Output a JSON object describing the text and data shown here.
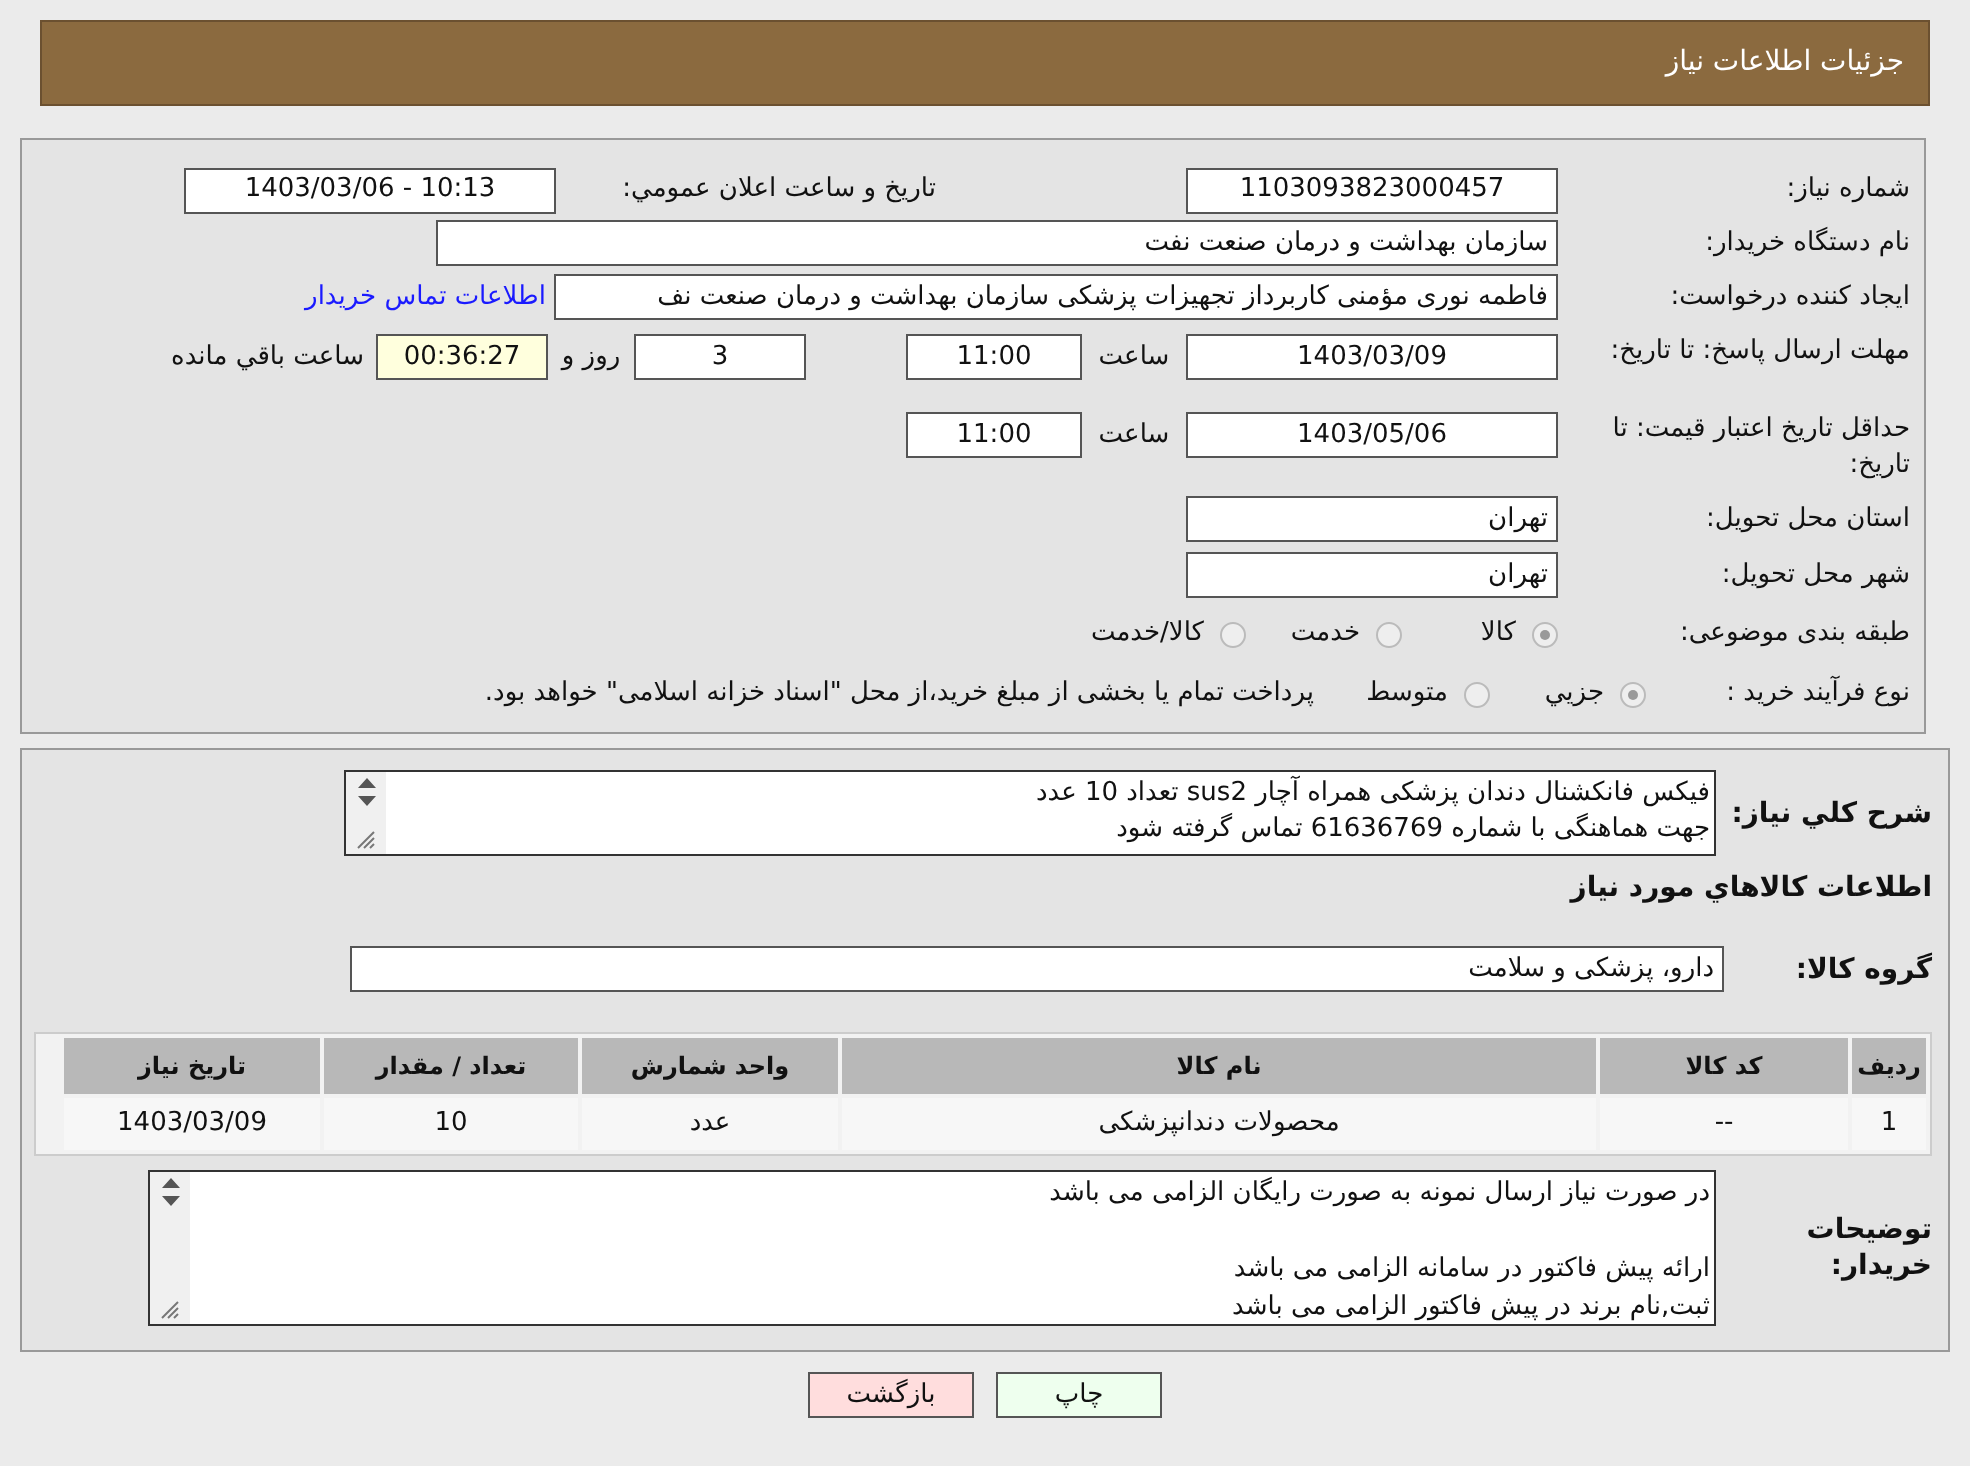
{
  "header": {
    "title": "جزئیات اطلاعات نیاز"
  },
  "need_number": {
    "label": "شماره نیاز:",
    "value": "1103093823000457"
  },
  "announce": {
    "label": "تاریخ و ساعت اعلان عمومي:",
    "value": "1403/03/06 - 10:13"
  },
  "buyer": {
    "label": "نام دستگاه خریدار:",
    "value": "سازمان بهداشت و درمان صنعت نفت"
  },
  "creator": {
    "label": "ایجاد کننده درخواست:",
    "value": "فاطمه نوری مؤمنی کاربرداز تجهیزات پزشکی سازمان بهداشت و درمان صنعت نف",
    "link": "اطلاعات تماس خریدار"
  },
  "deadline": {
    "label": "مهلت ارسال پاسخ: تا تاریخ:",
    "date": "1403/03/09",
    "time_label": "ساعت",
    "time": "11:00",
    "days": "3",
    "days_label": "روز و",
    "remaining": "00:36:27",
    "remaining_label": "ساعت باقي مانده"
  },
  "validity": {
    "label": "حداقل تاریخ اعتبار قیمت: تا تاریخ:",
    "date": "1403/05/06",
    "time_label": "ساعت",
    "time": "11:00"
  },
  "province": {
    "label": "استان محل تحویل:",
    "value": "تهران"
  },
  "city": {
    "label": "شهر محل تحویل:",
    "value": "تهران"
  },
  "category": {
    "label": "طبقه بندی موضوعی:",
    "options": [
      {
        "label": "کالا",
        "selected": true
      },
      {
        "label": "خدمت",
        "selected": false
      },
      {
        "label": "کالا/خدمت",
        "selected": false
      }
    ]
  },
  "purchase_type": {
    "label": "نوع فرآیند خرید :",
    "options": [
      {
        "label": "جزیي",
        "selected": true
      },
      {
        "label": "متوسط",
        "selected": false
      }
    ],
    "note": "پرداخت تمام یا بخشی از مبلغ خرید،از محل \"اسناد خزانه اسلامی\" خواهد بود."
  },
  "description": {
    "label": "شرح کلي نياز:",
    "lines": [
      "فیکس فانکشنال دندان پزشکی همراه آچار sus2 تعداد 10 عدد",
      "جهت هماهنگی با شماره 61636769 تماس گرفته شود"
    ]
  },
  "goods_heading": "اطلاعات کالاهاي مورد نياز",
  "goods_group": {
    "label": "گروه کالا:",
    "value": "دارو، پزشکی و سلامت"
  },
  "table": {
    "columns": [
      "ردیف",
      "کد کالا",
      "نام کالا",
      "واحد شمارش",
      "تعداد / مقدار",
      "تاریخ نیاز"
    ],
    "rows": [
      [
        "1",
        "--",
        "محصولات دندانپزشکی",
        "عدد",
        "10",
        "1403/03/09"
      ]
    ]
  },
  "buyer_notes": {
    "label": "توضیحات خریدار:",
    "paragraphs": [
      [
        "در صورت نیاز ارسال نمونه به صورت رایگان الزامی می باشد"
      ],
      [
        "ارائه پیش فاکتور در سامانه الزامی می باشد",
        "ثبت,نام برند در پیش فاکتور الزامی می باشد"
      ]
    ]
  },
  "buttons": [
    {
      "label": "چاپ",
      "kind": "print"
    },
    {
      "label": "بازگشت",
      "kind": "back"
    }
  ]
}
